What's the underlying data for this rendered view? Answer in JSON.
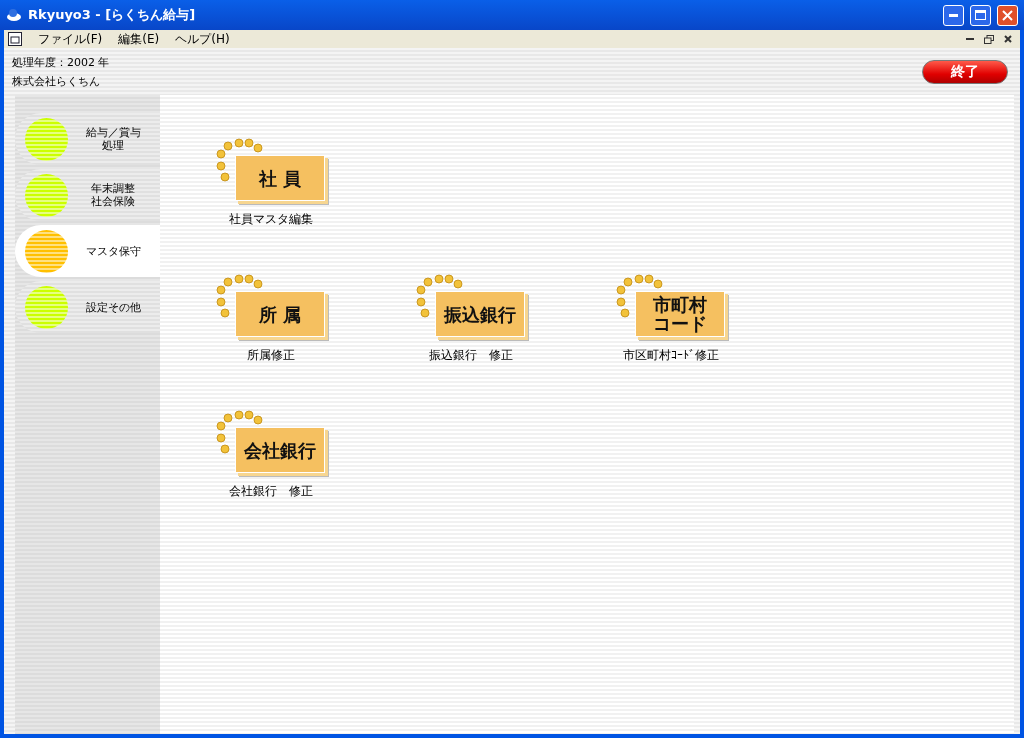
{
  "window": {
    "title": "Rkyuyo3 - [らくちん給与]"
  },
  "menu": [
    "ファイル(F)",
    "編集(E)",
    "ヘルプ(H)"
  ],
  "header": {
    "fiscal_year": "処理年度：2002 年",
    "company": "株式会社らくちん"
  },
  "exit_button": "終了",
  "sidebar": {
    "items": [
      {
        "lines": [
          "給与／賞与",
          "処理"
        ],
        "selected": false
      },
      {
        "lines": [
          "年末調整",
          "社会保険"
        ],
        "selected": false
      },
      {
        "lines": [
          "マスタ保守"
        ],
        "selected": true
      },
      {
        "lines": [
          "設定その他"
        ],
        "selected": false
      }
    ]
  },
  "tile_rows": [
    [
      {
        "icon_lines": [
          "社 員"
        ],
        "caption": "社員マスタ編集"
      }
    ],
    [
      {
        "icon_lines": [
          "所 属"
        ],
        "caption": "所属修正"
      },
      {
        "icon_lines": [
          "振込銀行"
        ],
        "caption": "振込銀行　修正"
      },
      {
        "icon_lines": [
          "市町村",
          "コード"
        ],
        "caption": "市区町村ｺｰﾄﾞ修正"
      }
    ],
    [
      {
        "icon_lines": [
          "会社銀行"
        ],
        "caption": "会社銀行　修正"
      }
    ]
  ]
}
